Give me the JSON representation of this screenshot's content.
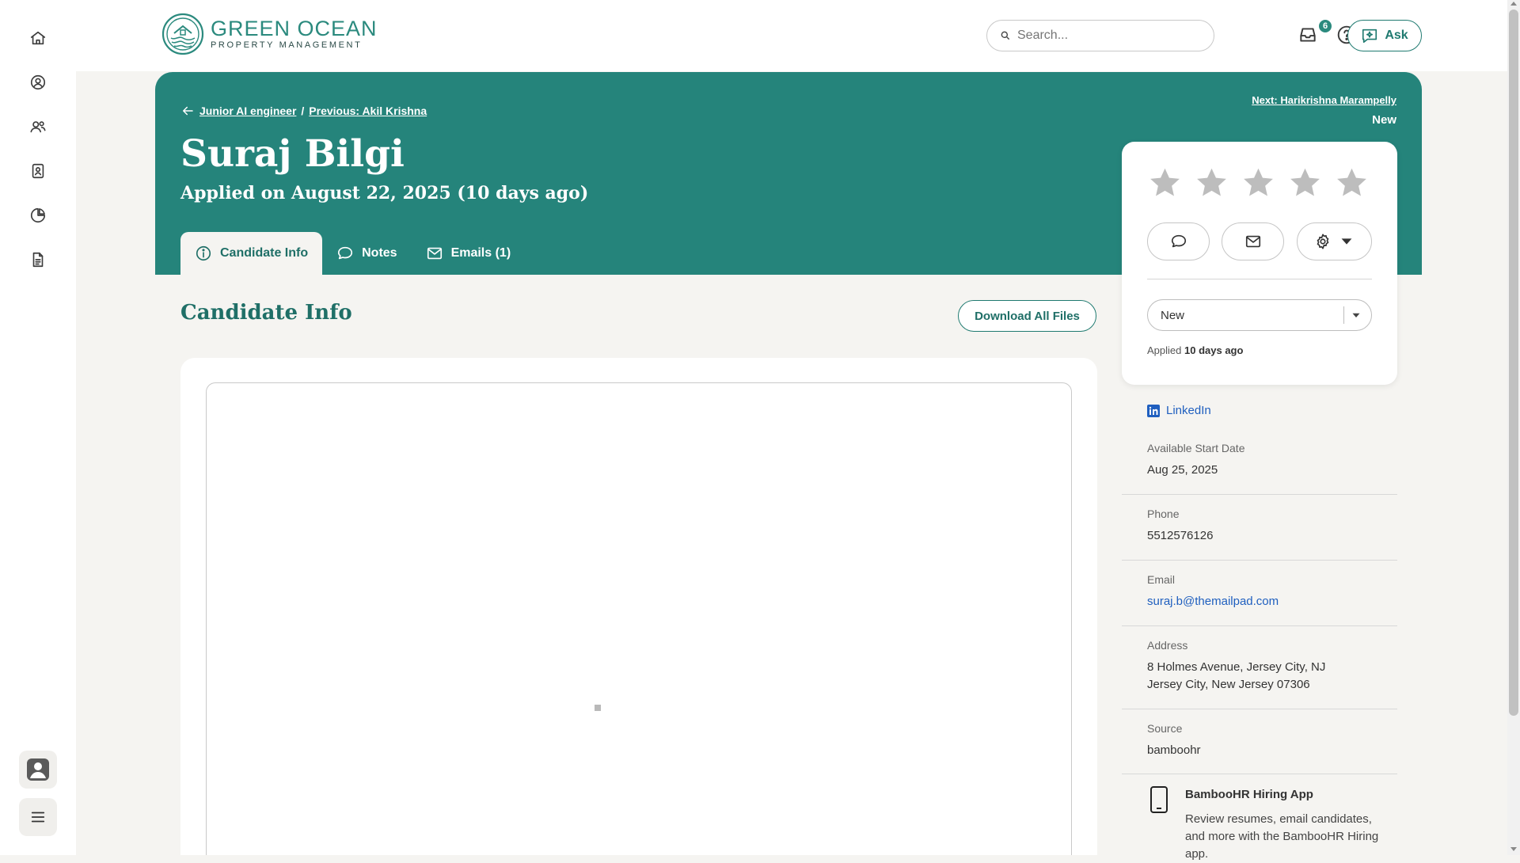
{
  "topbar": {
    "logo_line1": "GREEN OCEAN",
    "logo_line2": "PROPERTY MANAGEMENT",
    "search_placeholder": "Search...",
    "inbox_badge": "6",
    "ask_label": "Ask"
  },
  "rail": {
    "items": [
      "home-icon",
      "profile-icon",
      "people-icon",
      "directory-icon",
      "reports-icon",
      "files-icon"
    ],
    "bottom": [
      "avatar-icon",
      "menu-icon"
    ]
  },
  "header": {
    "back_link": "Junior AI engineer",
    "crumb_sep": "/",
    "prev_link": "Previous: Akil Krishna",
    "next_link": "Next: Harikrishna Marampelly",
    "next_status": "New",
    "name": "Suraj Bilgi",
    "applied": "Applied on August 22, 2025 (10 days ago)"
  },
  "tabs": [
    {
      "label": "Candidate Info",
      "icon": "info-icon",
      "active": true
    },
    {
      "label": "Notes",
      "icon": "comment-icon",
      "active": false
    },
    {
      "label": "Emails (1)",
      "icon": "mail-icon",
      "active": false
    }
  ],
  "main": {
    "section_title": "Candidate Info",
    "download_label": "Download All Files"
  },
  "rating_card": {
    "stars_total": 5,
    "stars_filled": 0,
    "status_value": "New",
    "applied_prefix": "Applied",
    "applied_ago": "10 days ago"
  },
  "details": {
    "linkedin": "LinkedIn",
    "start_label": "Available Start Date",
    "start_value": "Aug 25, 2025",
    "phone_label": "Phone",
    "phone_value": "5512576126",
    "email_label": "Email",
    "email_value": "suraj.b@themailpad.com",
    "address_label": "Address",
    "address_line1": "8 Holmes Avenue, Jersey City, NJ",
    "address_line2": "Jersey City, New Jersey 07306",
    "source_label": "Source",
    "source_value": "bamboohr"
  },
  "app_promo": {
    "title": "BambooHR Hiring App",
    "desc": "Review resumes, email candidates, and more with the BambooHR Hiring app."
  },
  "colors": {
    "brand_teal": "#25847b",
    "link_blue": "#1f5fbf",
    "star_gray": "#bdbdbd"
  }
}
